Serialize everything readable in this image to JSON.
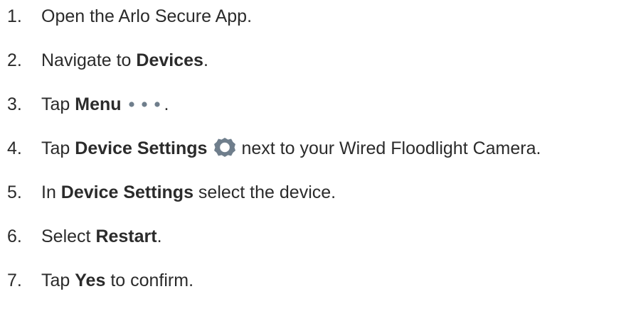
{
  "steps": [
    {
      "num": "1.",
      "parts": {
        "a": "Open the Arlo Secure App."
      }
    },
    {
      "num": "2.",
      "parts": {
        "a": "Navigate to ",
        "b": "Devices",
        "c": "."
      }
    },
    {
      "num": "3.",
      "parts": {
        "a": "Tap ",
        "b": "Menu",
        "c": "."
      }
    },
    {
      "num": "4.",
      "parts": {
        "a": "Tap ",
        "b": "Device Settings",
        "c": "next to your Wired Floodlight Camera."
      }
    },
    {
      "num": "5.",
      "parts": {
        "a": "In ",
        "b": "Device Settings",
        "c": " select the device."
      }
    },
    {
      "num": "6.",
      "parts": {
        "a": "Select ",
        "b": "Restart",
        "c": "."
      }
    },
    {
      "num": "7.",
      "parts": {
        "a": "Tap ",
        "b": "Yes",
        "c": " to confirm."
      }
    }
  ],
  "icons": {
    "menu": "more-dots-icon",
    "settings": "gear-icon"
  },
  "colors": {
    "text": "#2b2b2b",
    "icon": "#6f7e8c"
  }
}
